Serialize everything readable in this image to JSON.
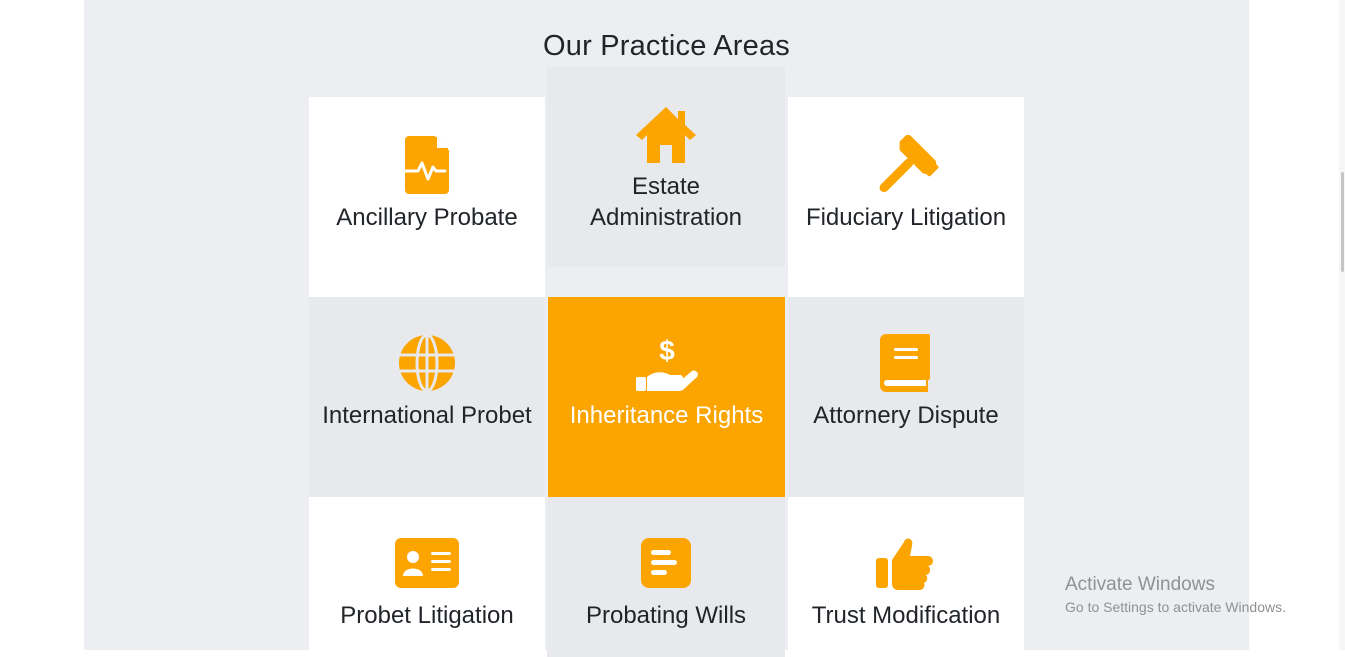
{
  "section": {
    "title": "Our Practice Areas"
  },
  "cards": [
    {
      "label": "Ancillary Probate",
      "icon": "file-medical-icon"
    },
    {
      "label": "Estate Administration",
      "icon": "house-icon"
    },
    {
      "label": "Fiduciary Litigation",
      "icon": "hammer-icon"
    },
    {
      "label": "International Probet",
      "icon": "globe-icon"
    },
    {
      "label": "Inheritance Rights",
      "icon": "hand-holding-dollar-icon"
    },
    {
      "label": "Attornery Dispute",
      "icon": "book-icon"
    },
    {
      "label": "Probet Litigation",
      "icon": "id-card-icon"
    },
    {
      "label": "Probating Wills",
      "icon": "list-document-icon"
    },
    {
      "label": "Trust Modification",
      "icon": "thumbs-up-icon"
    }
  ],
  "colors": {
    "accent": "#fca400",
    "section_bg": "#eceef1",
    "card_alt": "#e7e9ec",
    "text": "#212529"
  },
  "windows_watermark": {
    "heading": "Activate Windows",
    "subtext": "Go to Settings to activate Windows."
  }
}
